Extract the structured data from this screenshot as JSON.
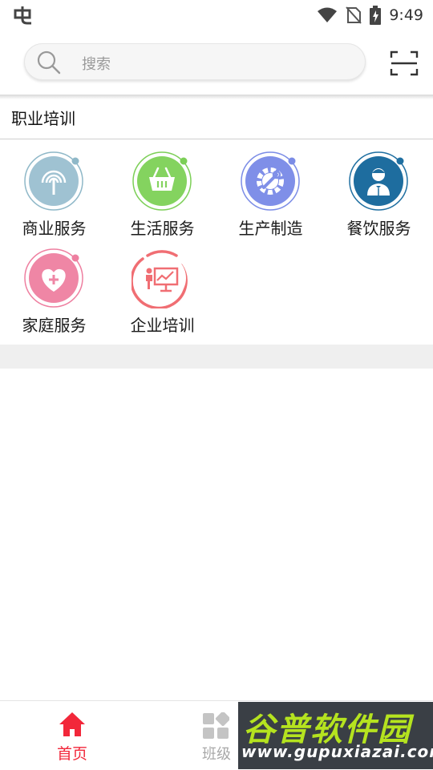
{
  "status_bar": {
    "time": "9:49",
    "left_icon": "app-notification-icon",
    "icons": [
      "wifi-icon",
      "no-sim-icon",
      "battery-charging-icon"
    ]
  },
  "search": {
    "placeholder": "搜索",
    "scan_icon": "scan-icon"
  },
  "section": {
    "title": "职业培训"
  },
  "categories": [
    {
      "label": "商业服务",
      "icon": "signal-tower-icon",
      "color": "#8fb8c8"
    },
    {
      "label": "生活服务",
      "icon": "basket-icon",
      "color": "#7ccf57"
    },
    {
      "label": "生产制造",
      "icon": "gear-wrench-icon",
      "color": "#7b8ce6"
    },
    {
      "label": "餐饮服务",
      "icon": "waiter-icon",
      "color": "#1f6fa1"
    },
    {
      "label": "家庭服务",
      "icon": "heart-plus-icon",
      "color": "#ee7fa0"
    },
    {
      "label": "企业培训",
      "icon": "presentation-icon",
      "color": "#f06e73"
    }
  ],
  "bottom_nav": {
    "home_label": "首页",
    "class_label": "班级",
    "active_color": "#f2273a"
  },
  "watermark": {
    "title": "谷普软件园",
    "url": "www.gupuxiazai.com"
  }
}
